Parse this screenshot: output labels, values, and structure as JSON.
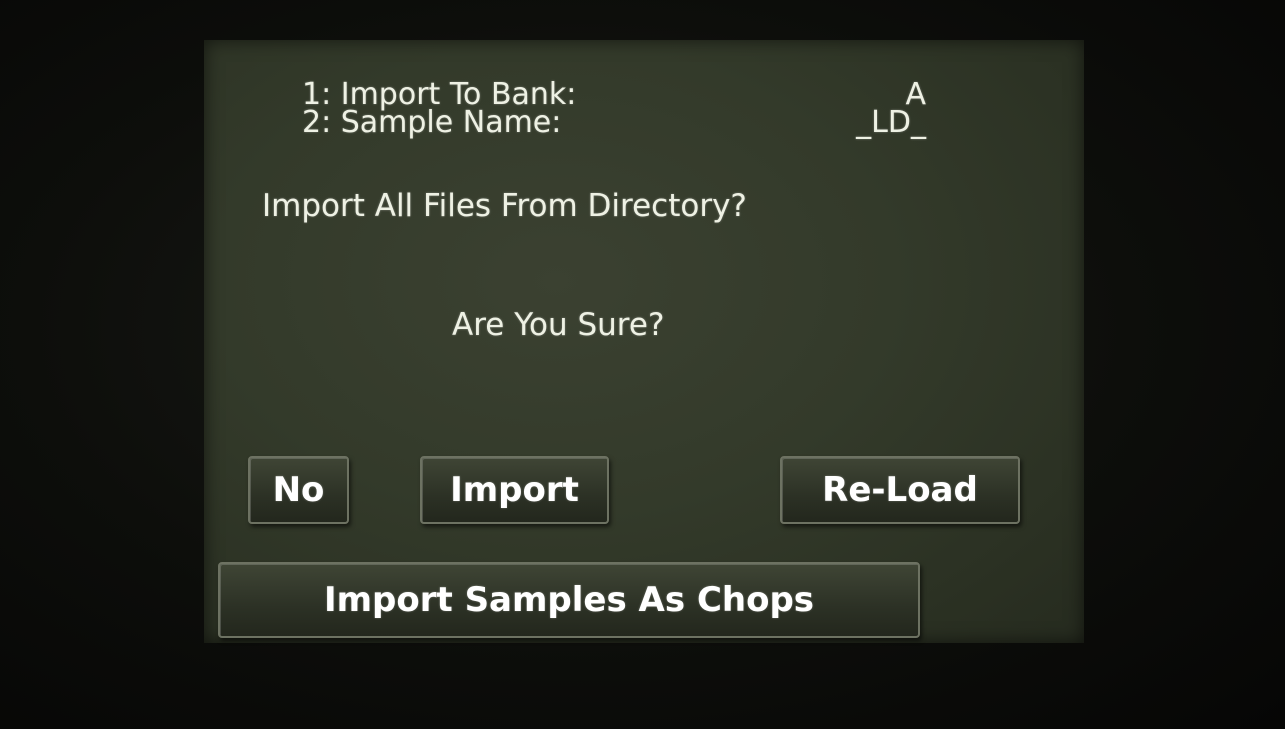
{
  "params": [
    {
      "label": "1: Import To Bank:",
      "value": "A"
    },
    {
      "label": "2: Sample Name:",
      "value": "_LD_"
    }
  ],
  "dialog": {
    "question": "Import All Files From Directory?",
    "confirm": "Are You Sure?"
  },
  "buttons": {
    "no": "No",
    "import": "Import",
    "reload": "Re-Load",
    "import_chops": "Import Samples As Chops"
  }
}
